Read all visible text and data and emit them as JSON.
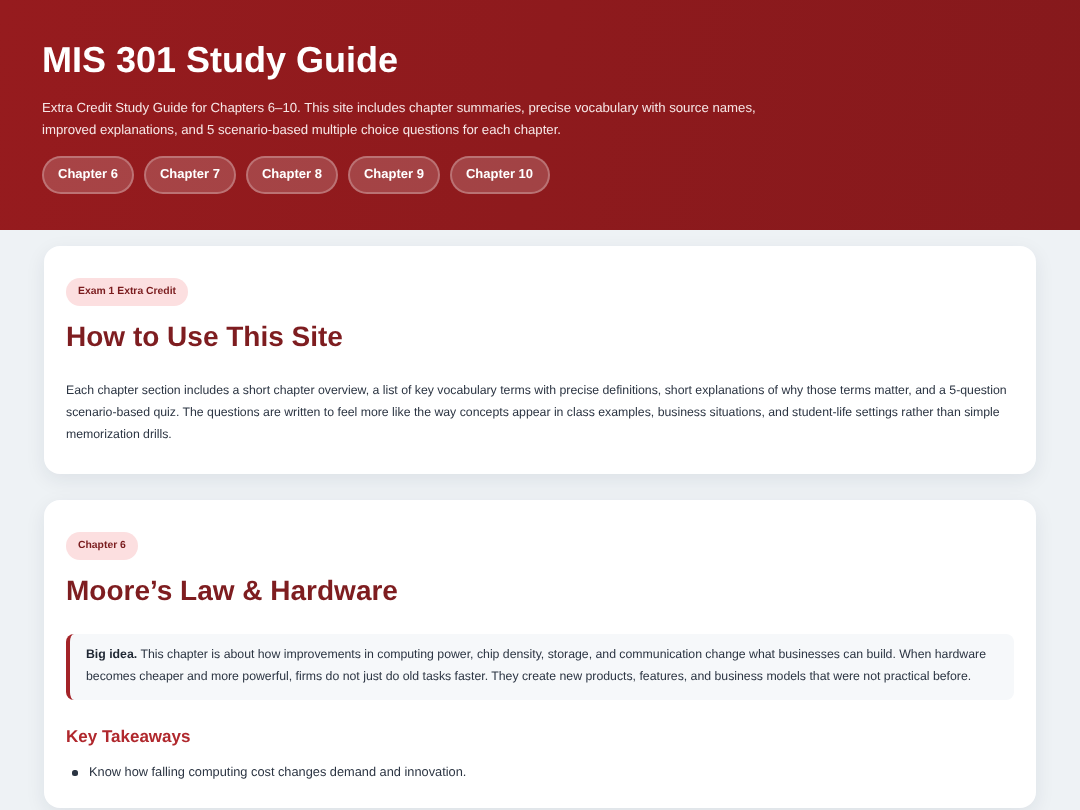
{
  "header": {
    "title": "MIS 301 Study Guide",
    "subtitle": "Extra Credit Study Guide for Chapters 6–10. This site includes chapter summaries, precise vocabulary with source names, improved explanations, and 5 scenario-based multiple choice questions for each chapter.",
    "chapter_links": [
      "Chapter 6",
      "Chapter 7",
      "Chapter 8",
      "Chapter 9",
      "Chapter 10"
    ]
  },
  "sections": [
    {
      "tag": "Exam 1 Extra Credit",
      "title": "How to Use This Site",
      "paragraph": "Each chapter section includes a short chapter overview, a list of key vocabulary terms with precise definitions, short explanations of why those terms matter, and a 5-question scenario-based quiz. The questions are written to feel more like the way concepts appear in class examples, business situations, and student-life settings rather than simple memorization drills."
    },
    {
      "tag": "Chapter 6",
      "title": "Moore’s Law & Hardware",
      "callout": "**Big idea.** This chapter is about how improvements in computing power, chip density, storage, and communication change what businesses can build. When hardware becomes cheaper and more powerful, firms do not just do old tasks faster. They create new products, features, and business models that were not practical before.",
      "subheading": "Key Takeaways",
      "bullets": [
        "Know how falling computing cost changes demand and innovation."
      ]
    }
  ]
}
